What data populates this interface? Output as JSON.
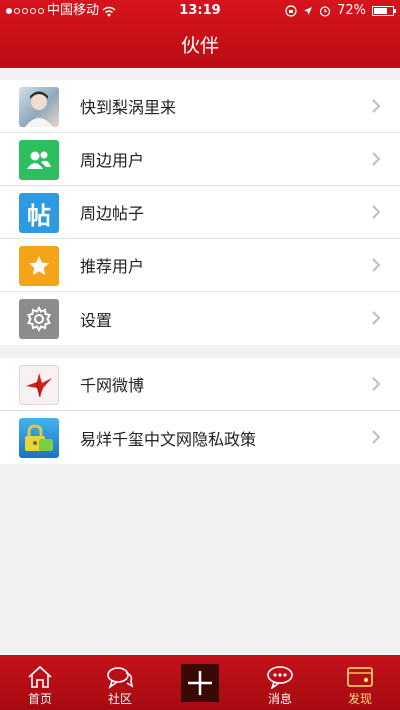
{
  "status_bar": {
    "carrier": "中国移动",
    "time": "13:19",
    "battery": "72%",
    "battery_level": 0.72
  },
  "header": {
    "title": "伙伴"
  },
  "list_group_1": [
    {
      "label": "快到梨涡里来",
      "icon": "user-avatar"
    },
    {
      "label": "周边用户",
      "icon": "people-icon",
      "color": "#2dbe60"
    },
    {
      "label": "周边帖子",
      "icon": "post-icon",
      "color": "#2e9be0",
      "icon_text": "帖"
    },
    {
      "label": "推荐用户",
      "icon": "star-icon",
      "color": "#f4a418"
    },
    {
      "label": "设置",
      "icon": "gear-icon",
      "color": "#8c8c8c"
    }
  ],
  "list_group_2": [
    {
      "label": "千网微博",
      "icon": "paper-crane-icon"
    },
    {
      "label": "易烊千玺中文网隐私政策",
      "icon": "lock-icon"
    }
  ],
  "tabbar": {
    "tabs": [
      {
        "label": "首页",
        "icon": "home-icon"
      },
      {
        "label": "社区",
        "icon": "chat-bubbles-icon"
      },
      {
        "label": "",
        "icon": "plus-icon"
      },
      {
        "label": "消息",
        "icon": "message-icon"
      },
      {
        "label": "发现",
        "icon": "discover-icon",
        "active": true
      }
    ]
  },
  "colors": {
    "brand": "#c8101a",
    "active_tab": "#ffdf7a"
  }
}
